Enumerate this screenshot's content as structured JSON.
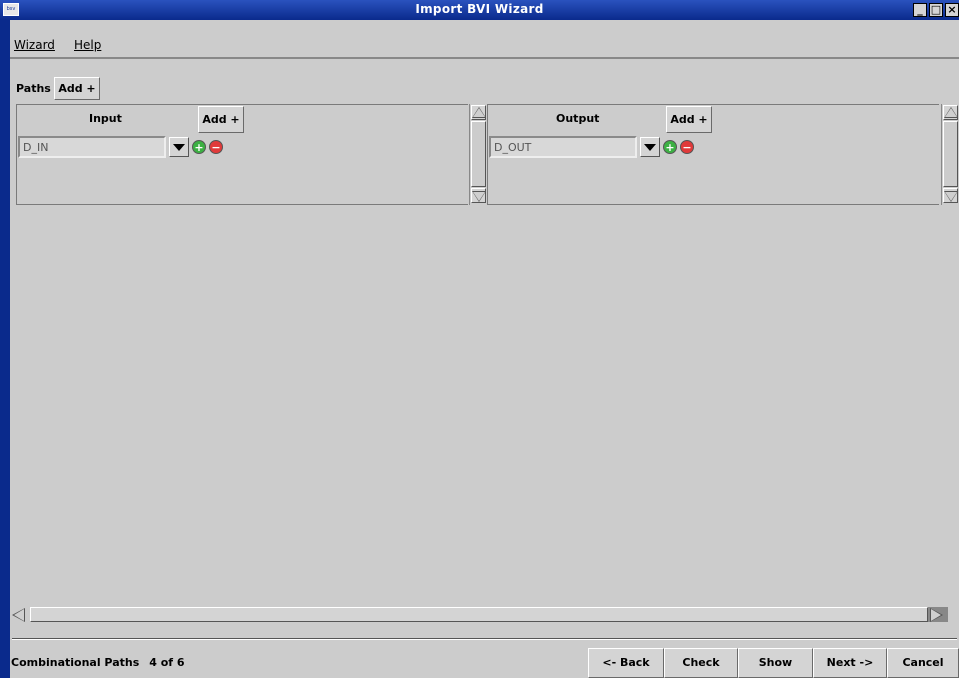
{
  "window": {
    "title": "Import BVI Wizard",
    "app_icon_text": "bsv",
    "controls": [
      "minimize",
      "maximize",
      "close"
    ]
  },
  "menu": {
    "items": [
      {
        "label": "Wizard",
        "mnemonic": "W"
      },
      {
        "label": "Help",
        "mnemonic": "H"
      }
    ]
  },
  "paths": {
    "label": "Paths",
    "add_label": "Add +"
  },
  "input_panel": {
    "header": "Input",
    "add_label": "Add +",
    "rows": [
      {
        "value": "D_IN"
      }
    ]
  },
  "output_panel": {
    "header": "Output",
    "add_label": "Add +",
    "rows": [
      {
        "value": "D_OUT"
      }
    ]
  },
  "status": {
    "step_name": "Combinational Paths",
    "step_progress": "4 of 6"
  },
  "buttons": {
    "back": "<- Back",
    "check": "Check",
    "show": "Show",
    "next": "Next ->",
    "cancel": "Cancel"
  }
}
